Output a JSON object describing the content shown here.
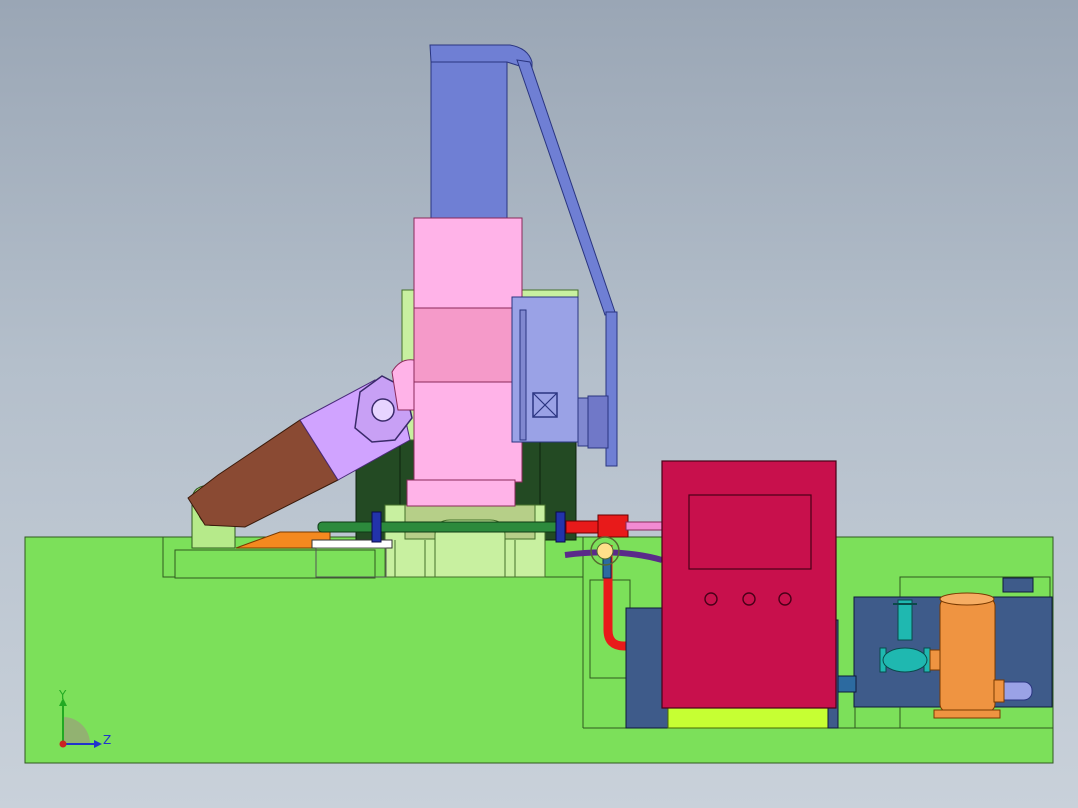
{
  "viewport": {
    "background": [
      "#9aa6b5",
      "#c9d1da"
    ]
  },
  "triad": {
    "y_label": "Y",
    "z_label": "Z",
    "y_color": "#22aa22",
    "z_color": "#2233cc",
    "x_color": "#cc2222"
  },
  "colors": {
    "base": "#7ce05a",
    "cylinder": "#6f7fd4",
    "pink_body": "#ffb3e8",
    "pink_mid": "#f59ac9",
    "motor": "#9aa2e6",
    "arm_tube": "#d0a3ff",
    "arm_brown": "#8a4a33",
    "control_box": "#c8104c",
    "panel_navy": "#3e5b8a",
    "tank": "#ef9441",
    "valve": "#1fb8b0",
    "pipe_red": "#e81a1a",
    "pipe_purple": "#5a2a8a",
    "pipe_green": "#2c8a3c",
    "dark_green": "#234a23",
    "lime": "#c6ff33",
    "orange_plate": "#f4891f"
  },
  "control_panel": {
    "buttons": 3
  }
}
